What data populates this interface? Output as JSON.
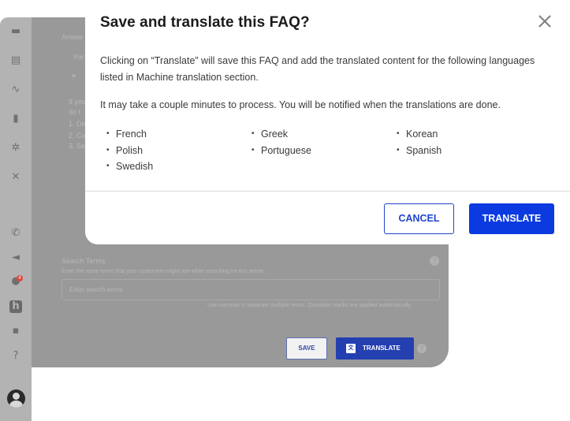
{
  "background_app": {
    "answer_label": "Answe",
    "paragraph_label": "Par",
    "quote_glyph": "❞",
    "body_lines": [
      "If you",
      "do I",
      "1. De",
      "2. Co",
      "3. Sel"
    ],
    "search_terms_title": "Search Terms",
    "search_terms_desc": "Enter the same terms that your customers might use while searching for this article.",
    "search_placeholder": "Enter search terms",
    "search_hint": "Use commas to separate multiple terms. Quotation marks are applied automatically.",
    "help_glyph": "?",
    "save_label": "SAVE",
    "translate_label": "TRANSLATE",
    "translate_icon_glyph": "文A",
    "notification_count": "4"
  },
  "sidebar": {
    "icons": [
      "chat-icon",
      "knowledge-icon",
      "activity-icon",
      "analytics-icon",
      "integrations-icon",
      "tools-icon",
      "phone-icon",
      "megaphone-icon",
      "bell-icon",
      "helpshift-logo-icon",
      "messages-icon",
      "help-icon",
      "avatar",
      "toggle"
    ]
  },
  "modal": {
    "title": "Save and translate this FAQ?",
    "paragraph1": "Clicking on “Translate” will save this FAQ and add the translated content for the following languages listed in Machine translation section.",
    "paragraph2": "It may take a couple minutes to process. You will be notified when the translations are done.",
    "languages_col1": [
      "French",
      "Polish",
      "Swedish"
    ],
    "languages_col2": [
      "Greek",
      "Portuguese"
    ],
    "languages_col3": [
      "Korean",
      "Spanish"
    ],
    "cancel_label": "CANCEL",
    "translate_label": "TRANSLATE"
  },
  "colors": {
    "primary": "#0a3ae0",
    "overlay": "#999999"
  }
}
